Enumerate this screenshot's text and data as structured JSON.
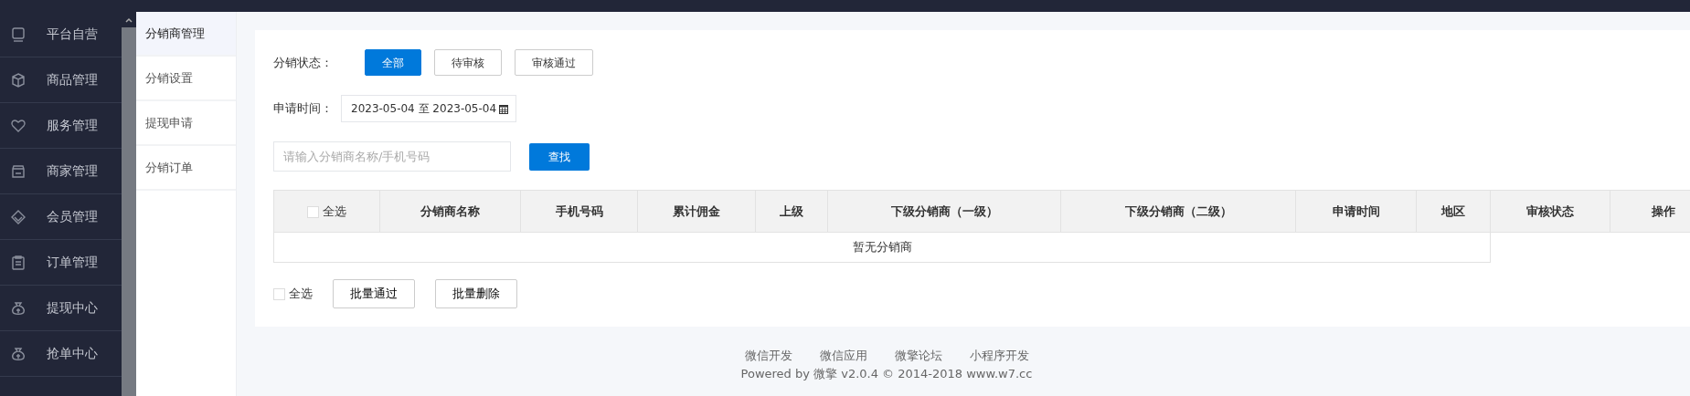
{
  "sidebar": {
    "items": [
      {
        "label": "平台自营"
      },
      {
        "label": "商品管理"
      },
      {
        "label": "服务管理"
      },
      {
        "label": "商家管理"
      },
      {
        "label": "会员管理"
      },
      {
        "label": "订单管理"
      },
      {
        "label": "提现中心"
      },
      {
        "label": "抢单中心"
      }
    ]
  },
  "subnav": {
    "items": [
      {
        "label": "分销商管理",
        "selected": true
      },
      {
        "label": "分销设置",
        "selected": false
      },
      {
        "label": "提现申请",
        "selected": false
      },
      {
        "label": "分销订单",
        "selected": false
      }
    ]
  },
  "filters": {
    "status_label": "分销状态：",
    "status_options": [
      {
        "label": "全部",
        "selected": true
      },
      {
        "label": "待审核",
        "selected": false
      },
      {
        "label": "审核通过",
        "selected": false
      }
    ],
    "date_label": "申请时间：",
    "date_range": "2023-05-04 至 2023-05-04",
    "search": {
      "placeholder": "请输入分销商名称/手机号码"
    },
    "search_button": "查找"
  },
  "table": {
    "select_all": {
      "label": "全选",
      "checked": false
    },
    "columns": [
      "分销商名称",
      "手机号码",
      "累计佣金",
      "上级",
      "下级分销商（一级）",
      "下级分销商（二级）",
      "申请时间",
      "地区",
      "审核状态",
      "操作"
    ],
    "empty_text": "暂无分销商"
  },
  "bulk": {
    "select_all": {
      "label": "全选",
      "checked": false
    },
    "buttons": [
      "批量通过",
      "批量删除"
    ]
  },
  "footer": {
    "links": [
      "微信开发",
      "微信应用",
      "微擎论坛",
      "小程序开发"
    ],
    "powered": "Powered by 微擎 v2.0.4 © 2014-2018 www.w7.cc"
  }
}
